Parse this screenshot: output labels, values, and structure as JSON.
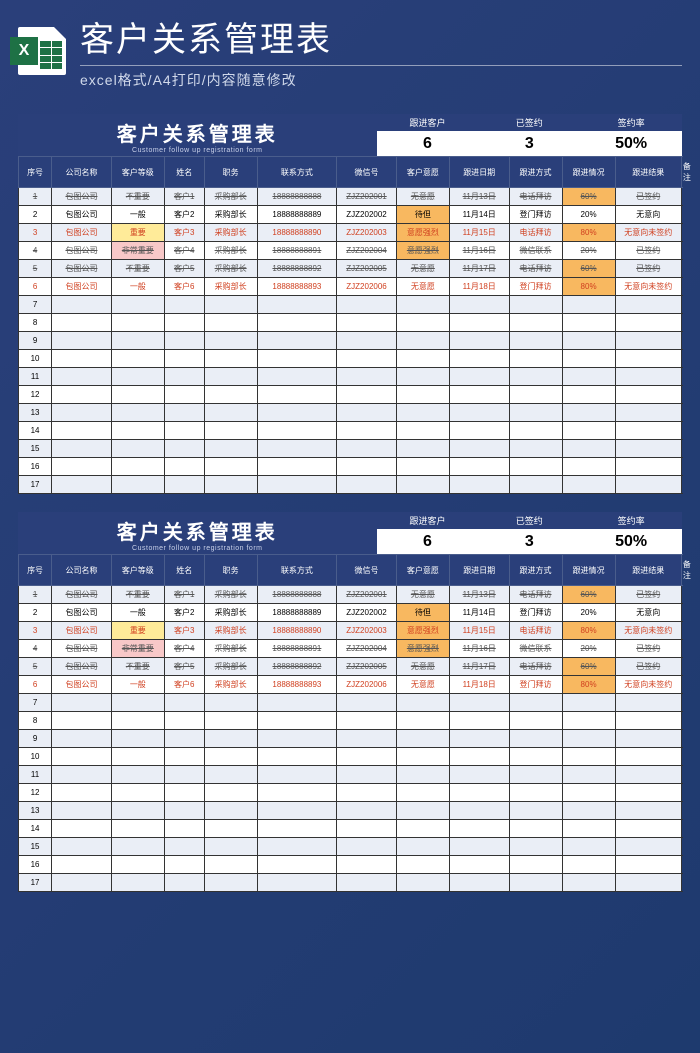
{
  "header": {
    "big_title": "客户关系管理表",
    "sub_title": "excel格式/A4打印/内容随意修改",
    "icon_letter": "X"
  },
  "sheet": {
    "title": "客户关系管理表",
    "subtitle": "Customer follow up registration form",
    "stats": [
      {
        "label": "跟进客户",
        "value": "6"
      },
      {
        "label": "已签约",
        "value": "3"
      },
      {
        "label": "签约率",
        "value": "50%"
      }
    ],
    "columns": [
      "序号",
      "公司名称",
      "客户等级",
      "姓名",
      "职务",
      "联系方式",
      "微信号",
      "客户意愿",
      "跟进日期",
      "跟进方式",
      "跟进情况",
      "跟进结果",
      "备注"
    ],
    "rows": [
      {
        "no": "1",
        "company": "包图公司",
        "level": "不重要",
        "name": "客户1",
        "job": "采购部长",
        "phone": "18888888888",
        "wx": "ZJZ202001",
        "will": "无意愿",
        "date": "11月13日",
        "method": "电话拜访",
        "progress": "60%",
        "result": "已签约",
        "note": "",
        "strike": true,
        "red": false,
        "level_hl": "",
        "will_hl": "",
        "progress_hl": "hl-orange"
      },
      {
        "no": "2",
        "company": "包图公司",
        "level": "一般",
        "name": "客户2",
        "job": "采购部长",
        "phone": "18888888889",
        "wx": "ZJZ202002",
        "will": "待但",
        "date": "11月14日",
        "method": "登门拜访",
        "progress": "20%",
        "result": "无意向",
        "note": "",
        "strike": false,
        "red": false,
        "level_hl": "",
        "will_hl": "hl-orange",
        "progress_hl": ""
      },
      {
        "no": "3",
        "company": "包图公司",
        "level": "重要",
        "name": "客户3",
        "job": "采购部长",
        "phone": "18888888890",
        "wx": "ZJZ202003",
        "will": "意愿强烈",
        "date": "11月15日",
        "method": "电话拜访",
        "progress": "80%",
        "result": "无意向未签约",
        "note": "",
        "strike": false,
        "red": true,
        "level_hl": "hl-yellow",
        "will_hl": "hl-orange",
        "progress_hl": "hl-orange"
      },
      {
        "no": "4",
        "company": "包图公司",
        "level": "非常重要",
        "name": "客户4",
        "job": "采购部长",
        "phone": "18888888891",
        "wx": "ZJZ202004",
        "will": "意愿强烈",
        "date": "11月16日",
        "method": "微信联系",
        "progress": "20%",
        "result": "已签约",
        "note": "",
        "strike": true,
        "red": false,
        "level_hl": "hl-pink",
        "will_hl": "hl-orange",
        "progress_hl": ""
      },
      {
        "no": "5",
        "company": "包图公司",
        "level": "不重要",
        "name": "客户5",
        "job": "采购部长",
        "phone": "18888888892",
        "wx": "ZJZ202005",
        "will": "无意愿",
        "date": "11月17日",
        "method": "电话拜访",
        "progress": "60%",
        "result": "已签约",
        "note": "",
        "strike": true,
        "red": false,
        "level_hl": "",
        "will_hl": "",
        "progress_hl": "hl-orange"
      },
      {
        "no": "6",
        "company": "包图公司",
        "level": "一般",
        "name": "客户6",
        "job": "采购部长",
        "phone": "18888888893",
        "wx": "ZJZ202006",
        "will": "无意愿",
        "date": "11月18日",
        "method": "登门拜访",
        "progress": "80%",
        "result": "无意向未签约",
        "note": "",
        "strike": false,
        "red": true,
        "level_hl": "",
        "will_hl": "",
        "progress_hl": "hl-orange"
      }
    ],
    "empty_rows": [
      "7",
      "8",
      "9",
      "10",
      "11",
      "12",
      "13",
      "14",
      "15",
      "16",
      "17"
    ]
  }
}
